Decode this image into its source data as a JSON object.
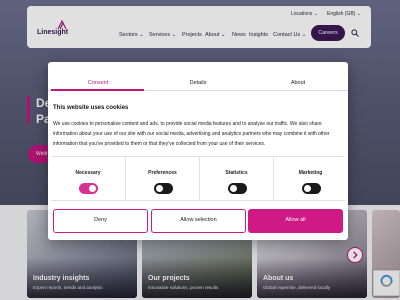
{
  "header": {
    "logo": "Linesight",
    "utility": {
      "locations": "Locations",
      "language": "English (GB)"
    },
    "nav": [
      "Sectors",
      "Services",
      "Projects",
      "About",
      "News",
      "Insights",
      "Contact Us"
    ],
    "careers": "Careers"
  },
  "hero": {
    "title_line1": "De",
    "title_line2": "Pa",
    "button_label": "Weld"
  },
  "cards": [
    {
      "title": "Industry insights",
      "subtitle": "Expert reports, trends and analysis"
    },
    {
      "title": "Our projects",
      "subtitle": "Innovative solutions, proven results"
    },
    {
      "title": "About us",
      "subtitle": "Global expertise, delivered locally"
    }
  ],
  "consent": {
    "tabs": [
      "Consent",
      "Details",
      "About"
    ],
    "title": "This website uses cookies",
    "text": "We use cookies to personalise content and ads, to provide social media features and to analyse our traffic. We also share information about your use of our site with our social media, advertising and analytics partners who may combine it with other information that you've provided to them or that they've collected from your use of their services.",
    "categories": [
      {
        "label": "Necessary",
        "state": "on-locked"
      },
      {
        "label": "Preferences",
        "state": "off"
      },
      {
        "label": "Statistics",
        "state": "off"
      },
      {
        "label": "Marketing",
        "state": "off"
      }
    ],
    "buttons": {
      "deny": "Deny",
      "selection": "Allow selection",
      "all": "Allow all"
    }
  },
  "colors": {
    "accent": "#cf1a85",
    "brand": "#3d1a56"
  }
}
